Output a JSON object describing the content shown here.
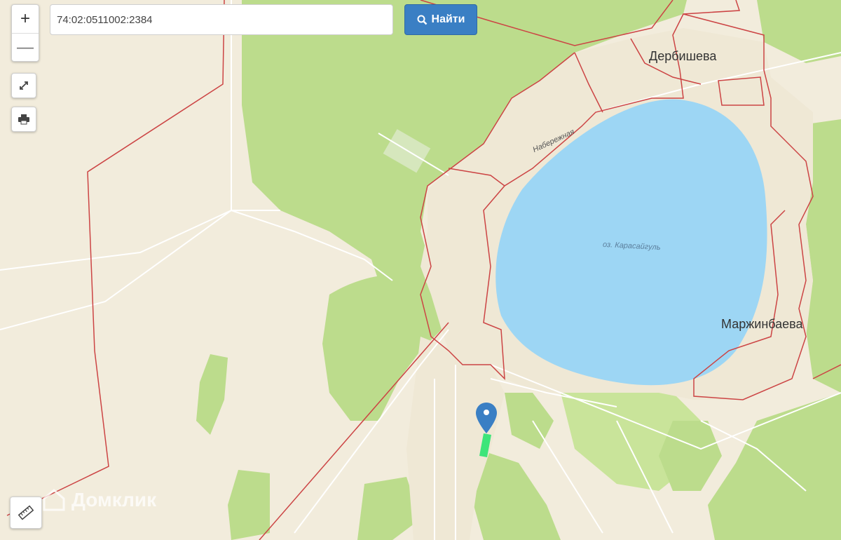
{
  "search": {
    "value": "74:02:0511002:2384",
    "button_label": "Найти"
  },
  "controls": {
    "zoom_in": "+",
    "zoom_out": "—",
    "icons": [
      "plus-icon",
      "minus-icon",
      "fullscreen-icon",
      "print-icon",
      "ruler-icon",
      "search-icon",
      "map-pin-icon"
    ]
  },
  "labels": {
    "village_north": "Дербишева",
    "village_east": "Маржинбаева",
    "lake": "оз. Карасайгуль",
    "street": "Набережная"
  },
  "watermark": "Домклик",
  "colors": {
    "background": "#f2ecdc",
    "forest": "#bcdc8c",
    "water": "#9dd6f4",
    "settlement": "#efe8d5",
    "boundary": "#cc4444",
    "marker": "#3a7fc4",
    "parcel": "#3ee57a"
  }
}
